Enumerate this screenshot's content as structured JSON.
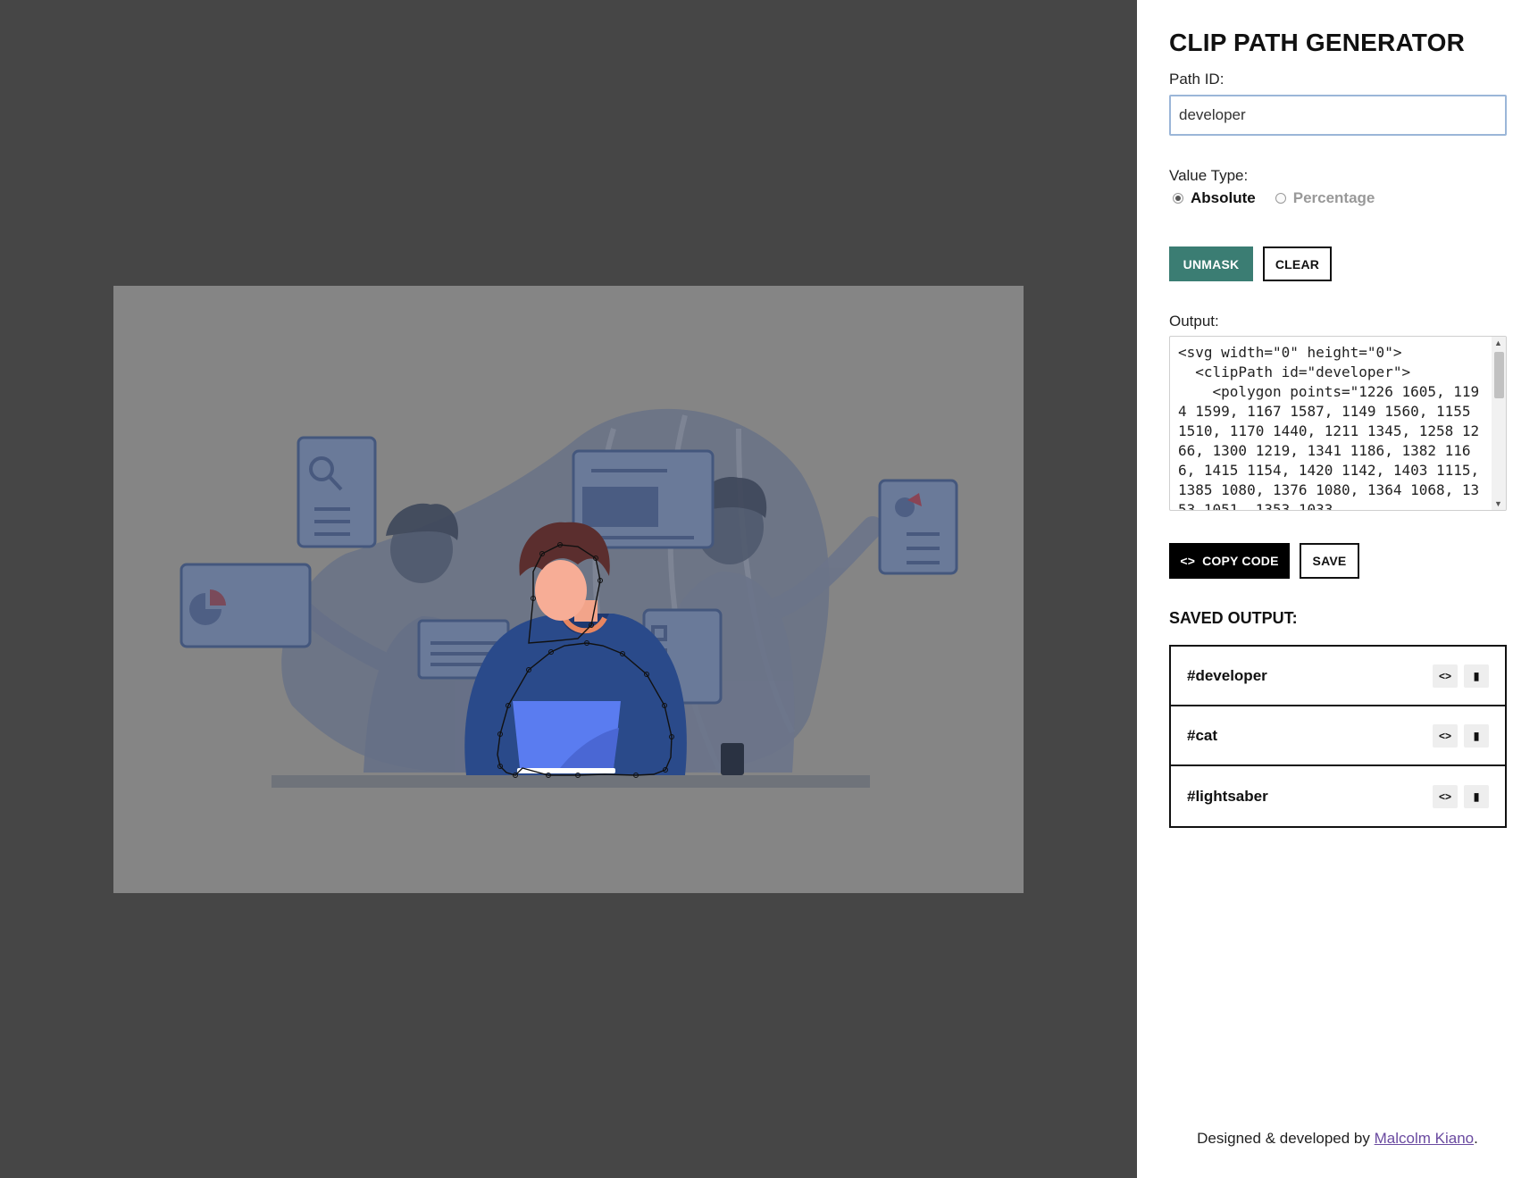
{
  "app": {
    "title": "CLIP PATH GENERATOR"
  },
  "path_id": {
    "label": "Path ID:",
    "value": "developer"
  },
  "value_type": {
    "label": "Value Type:",
    "options": [
      "Absolute",
      "Percentage"
    ],
    "selected": "Absolute"
  },
  "actions": {
    "unmask": "UNMASK",
    "clear": "CLEAR",
    "copy_code": "COPY CODE",
    "save": "SAVE"
  },
  "output": {
    "label": "Output:",
    "code": "<svg width=\"0\" height=\"0\">\n  <clipPath id=\"developer\">\n    <polygon points=\"1226 1605, 1194 1599, 1167 1587, 1149 1560, 1155 1510, 1170 1440, 1211 1345, 1258 1266, 1300 1219, 1341 1186, 1382 1166, 1415 1154, 1420 1142, 1403 1115, 1385 1080, 1376 1080, 1364 1068, 1353 1051, 1353 1033"
  },
  "saved": {
    "title": "SAVED OUTPUT:",
    "items": [
      "#developer",
      "#cat",
      "#lightsaber"
    ]
  },
  "footer": {
    "text": "Designed & developed by ",
    "author": "Malcolm Kiano",
    "end": "."
  },
  "colors": {
    "accent": "#3b7d73",
    "stage": "#464646",
    "dim_overlay": "#858585",
    "shirt": "#2a4a8a"
  }
}
